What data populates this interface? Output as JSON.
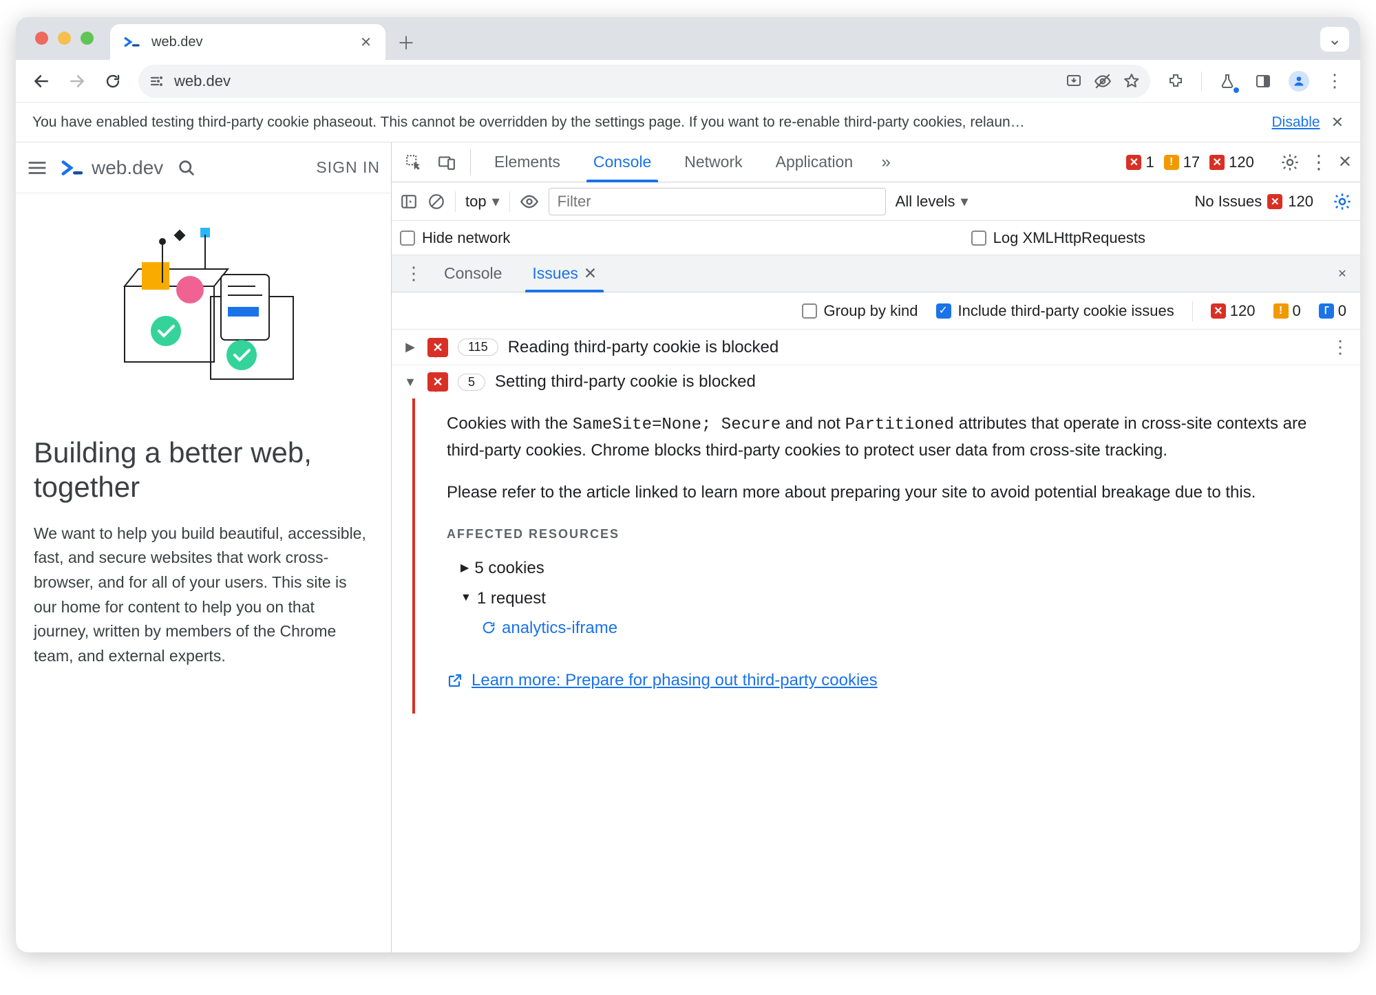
{
  "window": {
    "tab_title": "web.dev",
    "address": "web.dev"
  },
  "infobar": {
    "message": "You have enabled testing third-party cookie phaseout. This cannot be overridden by the settings page. If you want to re-enable third-party cookies, relaun…",
    "action": "Disable"
  },
  "page": {
    "brand": "web.dev",
    "signin": "SIGN IN",
    "hero_title": "Building a better web, together",
    "hero_body": "We want to help you build beautiful, accessible, fast, and secure websites that work cross-browser, and for all of your users. This site is our home for content to help you on that journey, written by members of the Chrome team, and external experts."
  },
  "devtools": {
    "tabs": [
      "Elements",
      "Console",
      "Network",
      "Application"
    ],
    "active_tab": "Console",
    "errors": "1",
    "warnings": "17",
    "issues_count": "120",
    "context": "top",
    "filter_placeholder": "Filter",
    "levels": "All levels",
    "no_issues_label": "No Issues",
    "no_issues_badge": "120",
    "hide_network": "Hide network",
    "log_xhr": "Log XMLHttpRequests",
    "drawer_tabs": [
      "Console",
      "Issues"
    ],
    "drawer_active": "Issues",
    "issues_toolbar": {
      "group_by_kind": "Group by kind",
      "include_3p": "Include third-party cookie issues",
      "red_count": "120",
      "orange_count": "0",
      "blue_count": "0"
    },
    "issue1": {
      "count": "115",
      "title": "Reading third-party cookie is blocked"
    },
    "issue2": {
      "count": "5",
      "title": "Setting third-party cookie is blocked",
      "p1a": "Cookies with the ",
      "code1": "SameSite=None; Secure",
      "p1b": " and not ",
      "code2": "Partitioned",
      "p1c": " attributes that operate in cross-site contexts are third-party cookies. Chrome blocks third-party cookies to protect user data from cross-site tracking.",
      "p2": "Please refer to the article linked to learn more about preparing your site to avoid potential breakage due to this.",
      "affected_label": "AFFECTED RESOURCES",
      "cookies": "5 cookies",
      "requests": "1 request",
      "request_link": "analytics-iframe",
      "learn_more": "Learn more: Prepare for phasing out third-party cookies"
    }
  },
  "colors": {
    "close": "#ed6a5e",
    "min": "#f5bf4f",
    "max": "#61c454",
    "blue": "#1a73e8",
    "red": "#d93025",
    "orange": "#f29900"
  }
}
